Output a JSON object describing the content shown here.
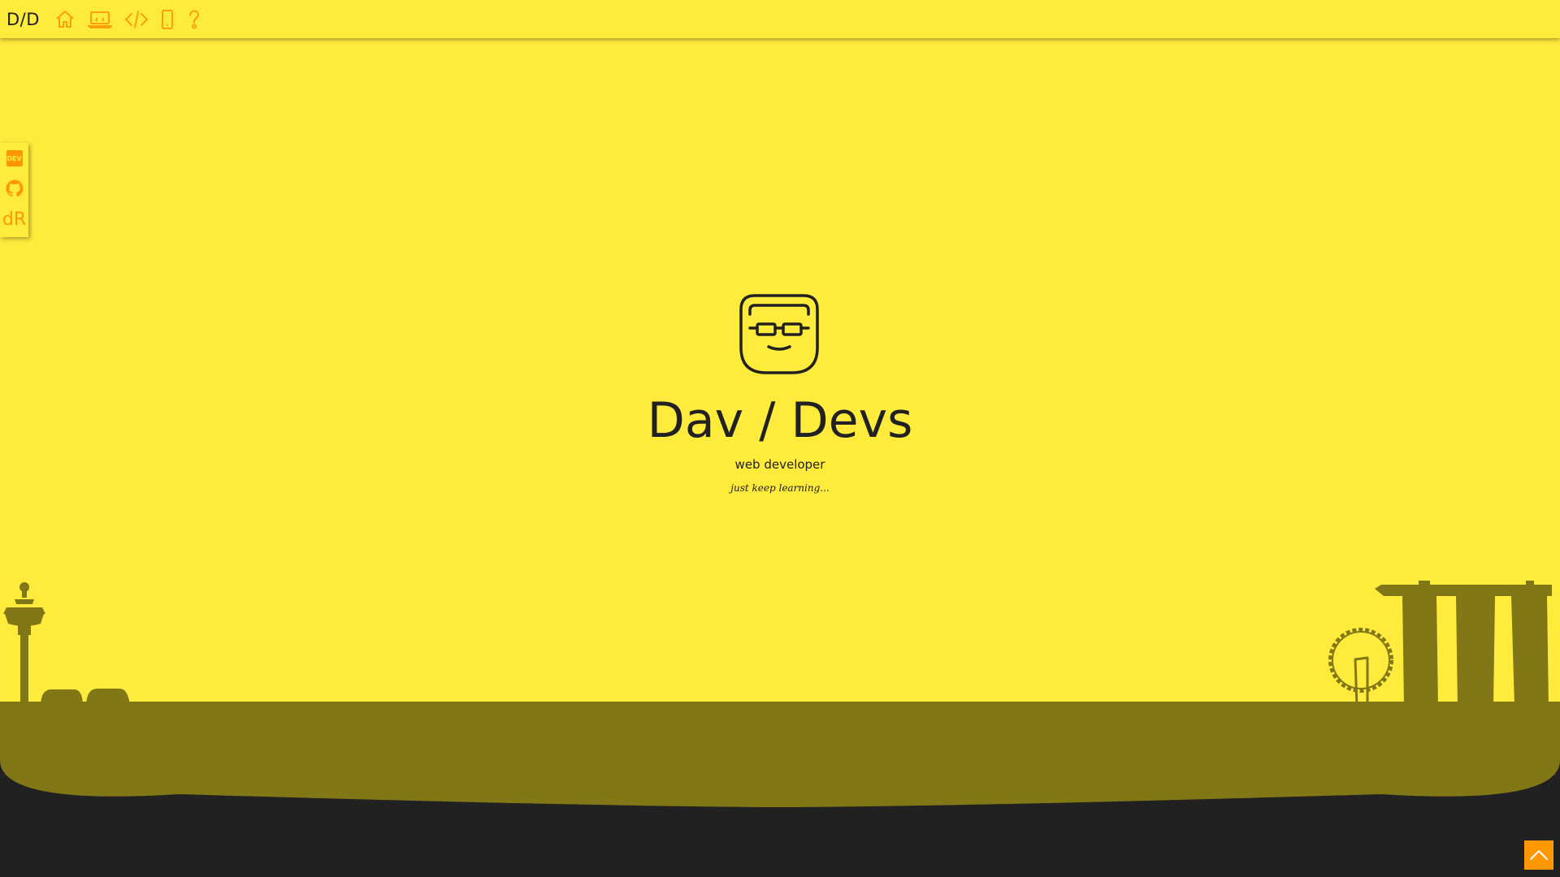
{
  "header": {
    "brand": "D/D",
    "nav": [
      {
        "name": "home",
        "icon": "home-icon"
      },
      {
        "name": "laptop",
        "icon": "laptop-icon"
      },
      {
        "name": "code",
        "icon": "code-icon"
      },
      {
        "name": "mobile",
        "icon": "mobile-icon"
      },
      {
        "name": "help",
        "icon": "question-icon"
      }
    ]
  },
  "social": {
    "dev_label": "DEV",
    "github_icon": "github-icon",
    "dr_label": "dR"
  },
  "hero": {
    "logo_icon": "developer-face-icon",
    "title": "Dav / Devs",
    "subtitle": "web developer",
    "tagline": "just keep learning..."
  },
  "footer": {
    "scroll_top_icon": "chevron-up-icon"
  },
  "colors": {
    "background": "#ffeb3b",
    "accent": "#ff9800",
    "text": "#212121",
    "skyline": "#827717",
    "ground": "#212121"
  }
}
